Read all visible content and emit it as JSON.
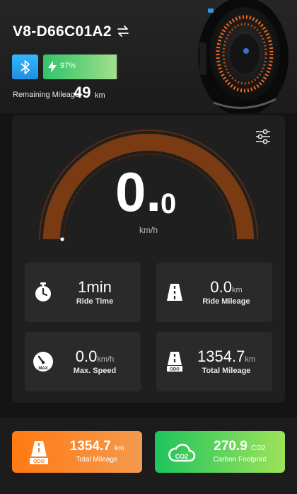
{
  "header": {
    "device_name": "V8-D66C01A2",
    "battery_percent_text": "97%",
    "battery_fraction": 0.97,
    "remaining_label": "Remaining Mileage",
    "remaining_value": "49",
    "remaining_unit": "km"
  },
  "speed": {
    "value_int": "0.",
    "value_dec": "0",
    "unit": "km/h",
    "gauge_fraction": 0
  },
  "stats": [
    {
      "value": "1min",
      "unit": "",
      "label": "Ride Time",
      "icon": "stopwatch-icon"
    },
    {
      "value": "0.0",
      "unit": "km",
      "label": "Ride Mileage",
      "icon": "road-icon"
    },
    {
      "value": "0.0",
      "unit": "km/h",
      "label": "Max. Speed",
      "icon": "speedometer-max-icon"
    },
    {
      "value": "1354.7",
      "unit": "km",
      "label": "Total Mileage",
      "icon": "odometer-icon"
    }
  ],
  "tiles": {
    "mileage": {
      "value": "1354.7",
      "unit": "km",
      "label": "Total Mileage"
    },
    "carbon": {
      "value": "270.9",
      "unit": "CO2",
      "label": "Carbon Footprint"
    }
  },
  "icon_text": {
    "max": "MAX",
    "odo": "ODO",
    "co2": "CO2"
  },
  "colors": {
    "bluetooth": "#2aa7f5",
    "battery": "#33c36a",
    "gauge_track": "#7a3b12",
    "tile_orange": "#ff7a12",
    "tile_green": "#1ec45c"
  }
}
